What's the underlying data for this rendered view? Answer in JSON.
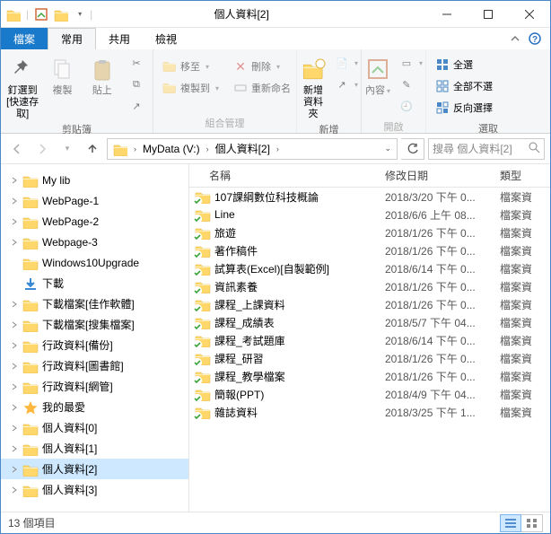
{
  "window": {
    "title": "個人資料[2]"
  },
  "qat": {
    "sep": "|"
  },
  "tabs": {
    "file": "檔案",
    "home": "常用",
    "share": "共用",
    "view": "檢視"
  },
  "ribbon": {
    "clipboard": {
      "label": "剪貼簿",
      "pin": "釘選到\n[快速存取]",
      "copy": "複製",
      "paste": "貼上"
    },
    "organize": {
      "label": "組合管理",
      "moveto": "移至",
      "copyto": "複製到",
      "delete": "刪除",
      "rename": "重新命名"
    },
    "new": {
      "label": "新增",
      "newfolder": "新增\n資料夾"
    },
    "open": {
      "label": "開啟",
      "properties": "內容"
    },
    "select": {
      "label": "選取",
      "selectall": "全選",
      "selectnone": "全部不選",
      "invert": "反向選擇"
    }
  },
  "breadcrumb": {
    "seg1": "MyData (V:)",
    "seg2": "個人資料[2]"
  },
  "search": {
    "placeholder": "搜尋 個人資料[2]"
  },
  "columns": {
    "name": "名稱",
    "date": "修改日期",
    "type": "類型"
  },
  "tree": [
    {
      "label": "My lib",
      "icon": "folder",
      "exp": "closed"
    },
    {
      "label": "WebPage-1",
      "icon": "folder",
      "exp": "closed"
    },
    {
      "label": "WebPage-2",
      "icon": "folder",
      "exp": "closed"
    },
    {
      "label": "Webpage-3",
      "icon": "folder",
      "exp": "closed"
    },
    {
      "label": "Windows10Upgrade",
      "icon": "folder",
      "exp": "none"
    },
    {
      "label": "下載",
      "icon": "download",
      "exp": "none"
    },
    {
      "label": "下載檔案[佳作軟體]",
      "icon": "folder",
      "exp": "closed"
    },
    {
      "label": "下載檔案[搜集檔案]",
      "icon": "folder",
      "exp": "closed"
    },
    {
      "label": "行政資料[備份]",
      "icon": "folder",
      "exp": "closed"
    },
    {
      "label": "行政資料[圖書館]",
      "icon": "folder",
      "exp": "closed"
    },
    {
      "label": "行政資料[網管]",
      "icon": "folder",
      "exp": "closed"
    },
    {
      "label": "我的最愛",
      "icon": "star",
      "exp": "closed"
    },
    {
      "label": "個人資料[0]",
      "icon": "folder",
      "exp": "closed"
    },
    {
      "label": "個人資料[1]",
      "icon": "folder",
      "exp": "closed"
    },
    {
      "label": "個人資料[2]",
      "icon": "folder",
      "exp": "closed",
      "selected": true
    },
    {
      "label": "個人資料[3]",
      "icon": "folder",
      "exp": "closed"
    }
  ],
  "files": [
    {
      "name": "107課綱數位科技概論",
      "date": "2018/3/20 下午 0...",
      "type": "檔案資"
    },
    {
      "name": "Line",
      "date": "2018/6/6 上午 08...",
      "type": "檔案資"
    },
    {
      "name": "旅遊",
      "date": "2018/1/26 下午 0...",
      "type": "檔案資"
    },
    {
      "name": "著作稿件",
      "date": "2018/1/26 下午 0...",
      "type": "檔案資"
    },
    {
      "name": "試算表(Excel)[自製範例]",
      "date": "2018/6/14 下午 0...",
      "type": "檔案資"
    },
    {
      "name": "資訊素養",
      "date": "2018/1/26 下午 0...",
      "type": "檔案資"
    },
    {
      "name": "課程_上課資料",
      "date": "2018/1/26 下午 0...",
      "type": "檔案資"
    },
    {
      "name": "課程_成績表",
      "date": "2018/5/7 下午 04...",
      "type": "檔案資"
    },
    {
      "name": "課程_考試題庫",
      "date": "2018/6/14 下午 0...",
      "type": "檔案資"
    },
    {
      "name": "課程_研習",
      "date": "2018/1/26 下午 0...",
      "type": "檔案資"
    },
    {
      "name": "課程_教學檔案",
      "date": "2018/1/26 下午 0...",
      "type": "檔案資"
    },
    {
      "name": "簡報(PPT)",
      "date": "2018/4/9 下午 04...",
      "type": "檔案資"
    },
    {
      "name": "雜誌資料",
      "date": "2018/3/25 下午 1...",
      "type": "檔案資"
    }
  ],
  "status": {
    "count": "13 個項目"
  }
}
